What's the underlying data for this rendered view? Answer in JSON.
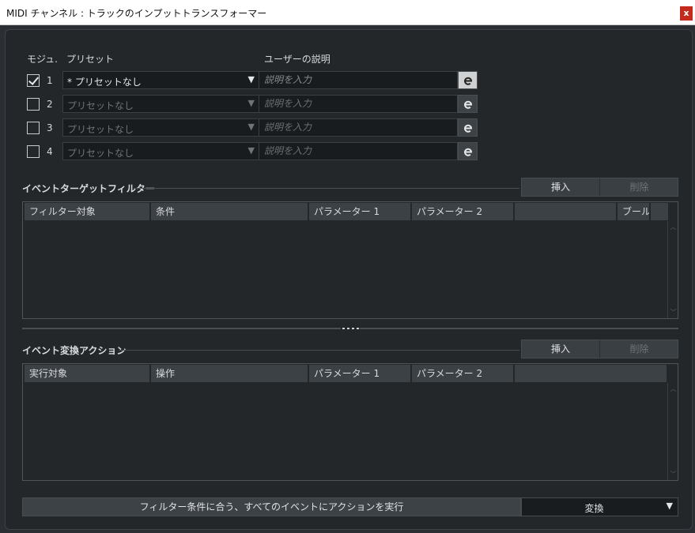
{
  "window": {
    "title": "MIDI チャンネル : トラックのインプットトランスフォーマー",
    "close_label": "x"
  },
  "modules": {
    "header_module": "モジュ.",
    "header_preset": "プリセット",
    "header_description": "ユーザーの説明",
    "rows": [
      {
        "checked": true,
        "number": "1",
        "preset": "* プリセットなし",
        "placeholder": "説明を入力"
      },
      {
        "checked": false,
        "number": "2",
        "preset": "プリセットなし",
        "placeholder": "説明を入力"
      },
      {
        "checked": false,
        "number": "3",
        "preset": "プリセットなし",
        "placeholder": "説明を入力"
      },
      {
        "checked": false,
        "number": "4",
        "preset": "プリセットなし",
        "placeholder": "説明を入力"
      }
    ],
    "dropdown_arrow": "▼"
  },
  "filter": {
    "title": "イベントターゲットフィルター",
    "insert_label": "挿入",
    "delete_label": "削除",
    "columns": [
      "フィルター対象",
      "条件",
      "パラメーター 1",
      "パラメーター 2",
      "",
      "ブール"
    ]
  },
  "action": {
    "title": "イベント変換アクション",
    "insert_label": "挿入",
    "delete_label": "削除",
    "columns": [
      "実行対象",
      "操作",
      "パラメーター 1",
      "パラメーター 2",
      ""
    ]
  },
  "footer": {
    "execute_label": "フィルター条件に合う、すべてのイベントにアクションを実行",
    "mode_value": "変換",
    "mode_arrow": "▼"
  }
}
